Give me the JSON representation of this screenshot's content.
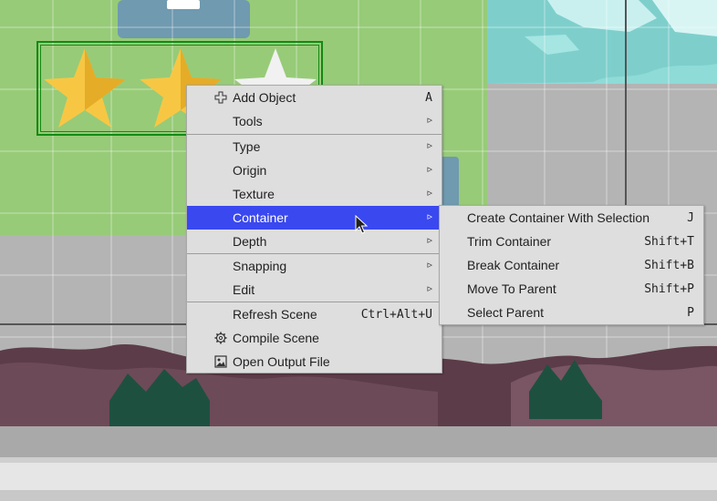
{
  "context_menu": {
    "items": [
      {
        "label": "Add Object",
        "shortcut": "A",
        "icon": "plus-icon"
      },
      {
        "label": "Tools",
        "arrow": "▹"
      },
      {
        "label": "Type",
        "arrow": "▹"
      },
      {
        "label": "Origin",
        "arrow": "▹"
      },
      {
        "label": "Texture",
        "arrow": "▹"
      },
      {
        "label": "Container",
        "arrow": "▹",
        "active": true
      },
      {
        "label": "Depth",
        "arrow": "▹"
      },
      {
        "label": "Snapping",
        "arrow": "▹"
      },
      {
        "label": "Edit",
        "arrow": "▹"
      },
      {
        "label": "Refresh Scene",
        "shortcut": "Ctrl+Alt+U"
      },
      {
        "label": "Compile Scene",
        "icon": "gear-icon"
      },
      {
        "label": "Open Output File",
        "icon": "file-image-icon"
      }
    ]
  },
  "container_submenu": {
    "items": [
      {
        "label": "Create Container With Selection",
        "shortcut": "J"
      },
      {
        "label": "Trim Container",
        "shortcut": "Shift+T"
      },
      {
        "label": "Break Container",
        "shortcut": "Shift+B"
      },
      {
        "label": "Move To Parent",
        "shortcut": "Shift+P"
      },
      {
        "label": "Select Parent",
        "shortcut": "P"
      }
    ]
  },
  "colors": {
    "menu_highlight": "#3a48f0",
    "menu_background": "#dedede",
    "scene_green": "#97cb78",
    "selection_outline": "#138a13"
  }
}
